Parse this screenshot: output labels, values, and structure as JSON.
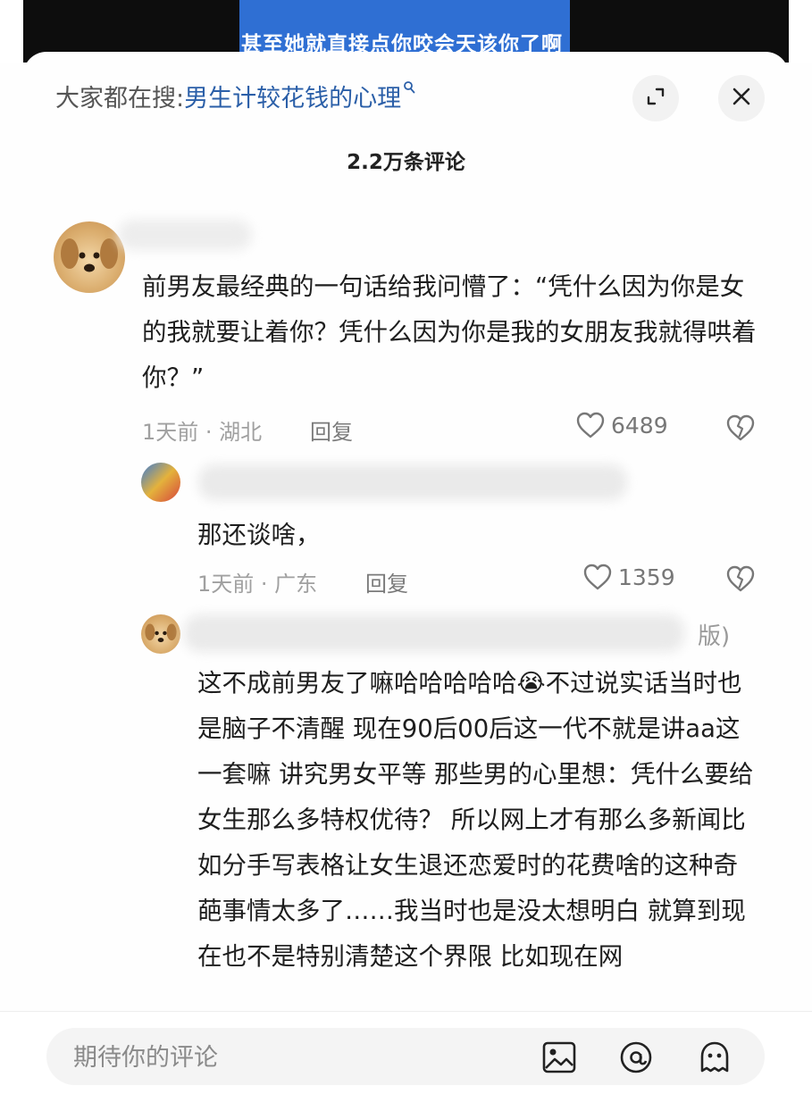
{
  "video": {
    "subtitle_fragment": "甚至她就直接点你咬会天该你了啊"
  },
  "header": {
    "search_prefix": "大家都在搜:",
    "search_query": "男生计较花钱的心理",
    "comment_count": "2.2万条评论"
  },
  "comments": [
    {
      "text": "前男友最经典的一句话给我问懵了：“凭什么因为你是女的我就要让着你？凭什么因为你是我的女朋友我就得哄着你？”",
      "time": "1天前",
      "location": "湖北",
      "reply_label": "回复",
      "likes": "6489"
    },
    {
      "text": "那还谈啥，",
      "time": "1天前",
      "location": "广东",
      "reply_label": "回复",
      "likes": "1359"
    },
    {
      "name_suffix": "版)",
      "text": "这不成前男友了嘛哈哈哈哈哈😭不过说实话当时也是脑子不清醒 现在90后00后这一代不就是讲aa这一套嘛 讲究男女平等 那些男的心里想：凭什么要给女生那么多特权优待？ 所以网上才有那么多新闻比如分手写表格让女生退还恋爱时的花费啥的这种奇葩事情太多了……我当时也是没太想明白 就算到现在也不是特别清楚这个界限 比如现在网"
    }
  ],
  "composer": {
    "placeholder": "期待你的评论"
  },
  "icons": {
    "search": "search-icon",
    "collapse": "collapse-icon",
    "close": "close-icon",
    "like": "heart-icon",
    "dislike": "broken-heart-icon",
    "image": "image-icon",
    "mention": "at-icon",
    "emoji": "emoji-icon"
  }
}
